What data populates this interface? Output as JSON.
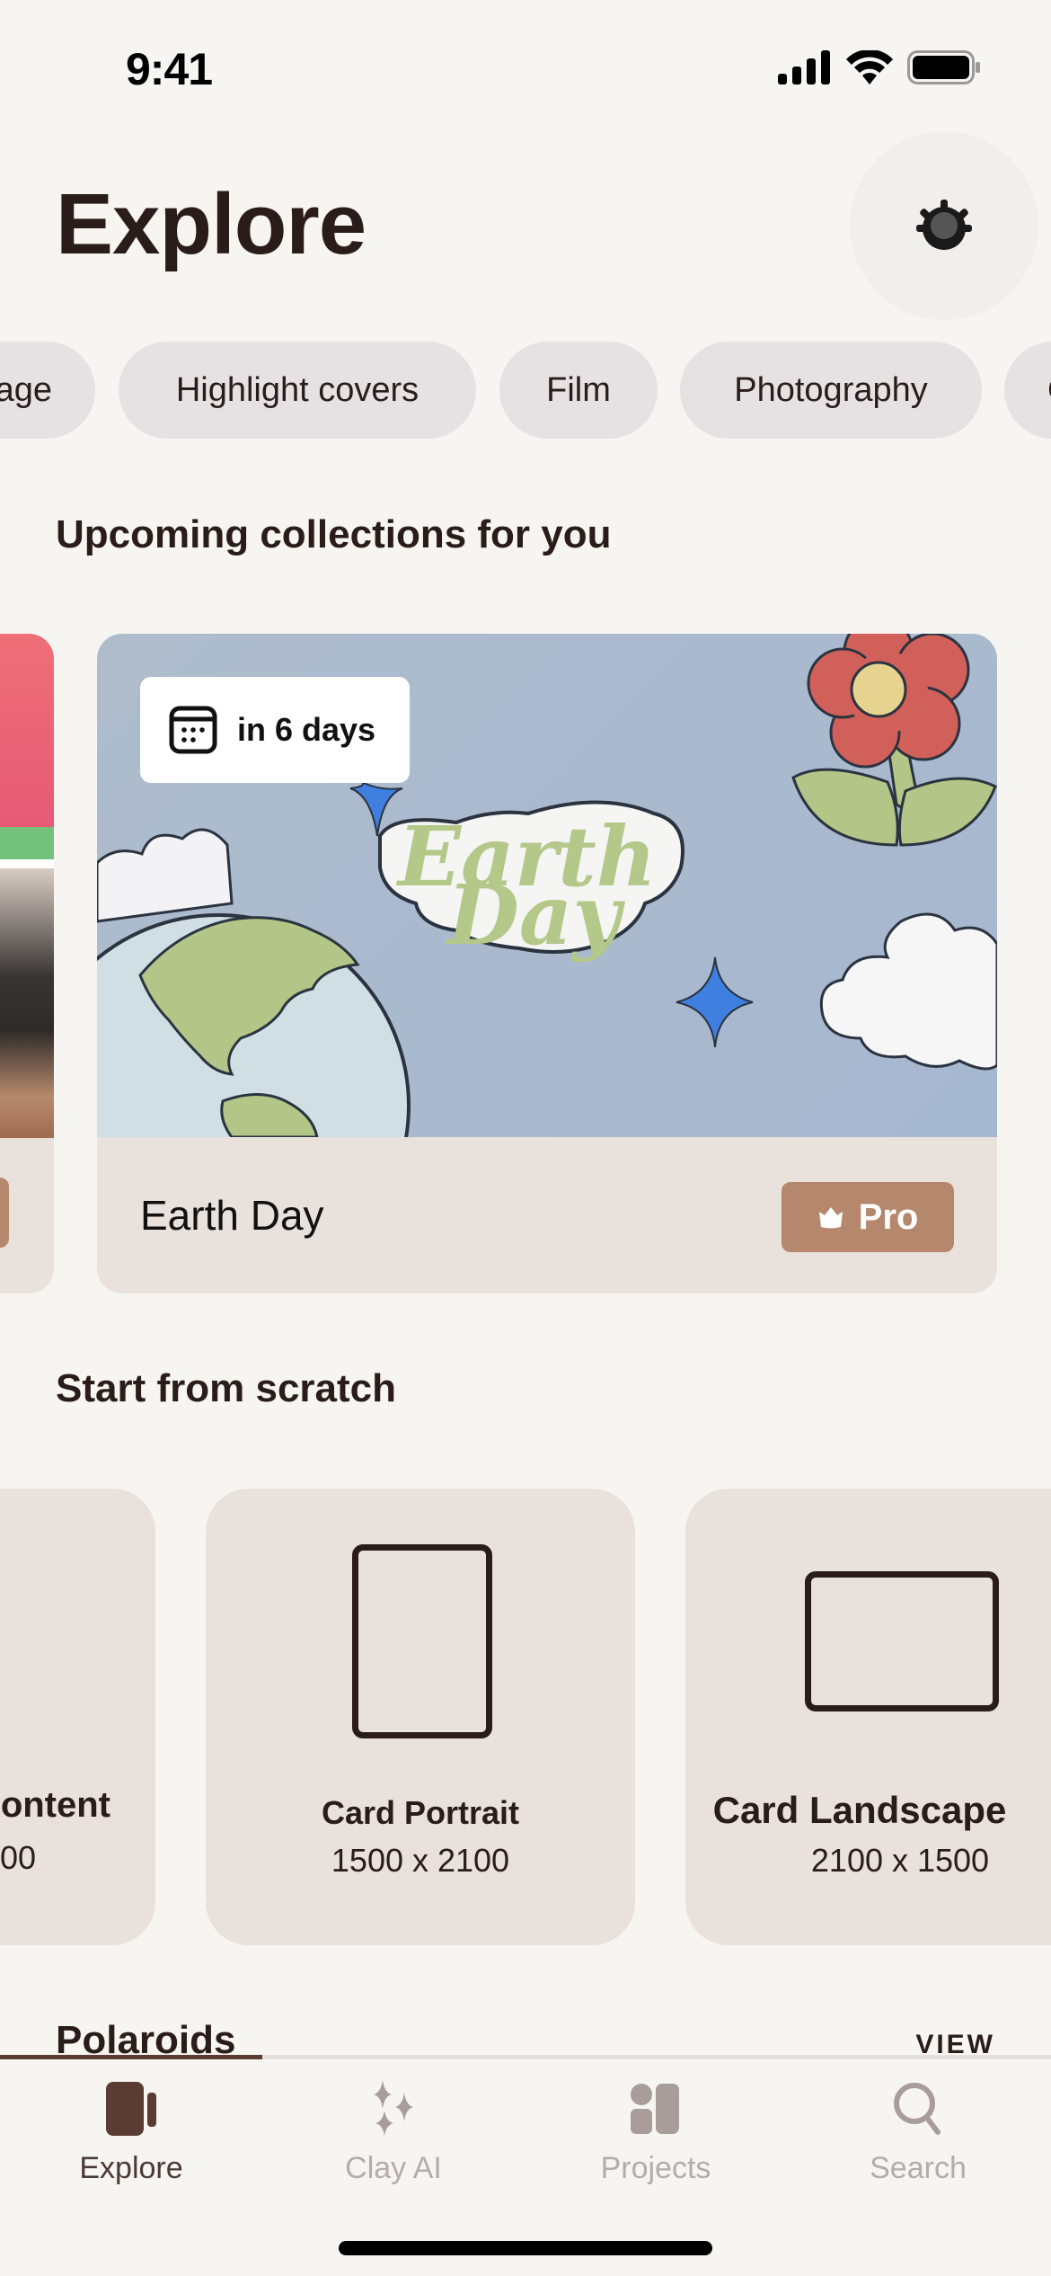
{
  "status_bar": {
    "time": "9:41",
    "icons": [
      "cellular-signal-icon",
      "wifi-icon",
      "battery-icon"
    ]
  },
  "header": {
    "title": "Explore",
    "settings_icon": "gear-icon"
  },
  "chips": [
    {
      "label": "age",
      "truncated": true
    },
    {
      "label": "Highlight covers"
    },
    {
      "label": "Film"
    },
    {
      "label": "Photography"
    },
    {
      "label": "C",
      "truncated": true
    }
  ],
  "upcoming": {
    "title": "Upcoming collections for you",
    "cards": [
      {
        "name": "Earth Day",
        "date_badge": "in 6 days",
        "date_icon": "calendar-icon",
        "art_text_line1": "Earth",
        "art_text_line2": "Day",
        "badge": {
          "label": "Pro",
          "icon": "crown-icon",
          "color": "#b5876d"
        }
      }
    ]
  },
  "scratch": {
    "title": "Start from scratch",
    "cards": [
      {
        "name": "ontent",
        "dims": "00",
        "truncated": true
      },
      {
        "name": "Card Portrait",
        "dims": "1500 x 2100",
        "shape": "portrait"
      },
      {
        "name": "Card Landscape",
        "dims": "2100 x 1500",
        "shape": "landscape"
      }
    ]
  },
  "polaroids": {
    "title": "Polaroids",
    "view_label": "VIEW"
  },
  "tab_bar": {
    "tabs": [
      {
        "label": "Explore",
        "icon": "explore-icon",
        "active": true
      },
      {
        "label": "Clay AI",
        "icon": "sparkles-icon",
        "active": false
      },
      {
        "label": "Projects",
        "icon": "projects-icon",
        "active": false
      },
      {
        "label": "Search",
        "icon": "search-icon",
        "active": false
      }
    ]
  },
  "colors": {
    "background": "#f7f5f2",
    "text": "#2a1c19",
    "chip": "#e6e2e3",
    "card": "#e9e1dc",
    "pro": "#b5876d",
    "tab_active": "#5a3c33",
    "tab_inactive": "#a89d9b"
  }
}
